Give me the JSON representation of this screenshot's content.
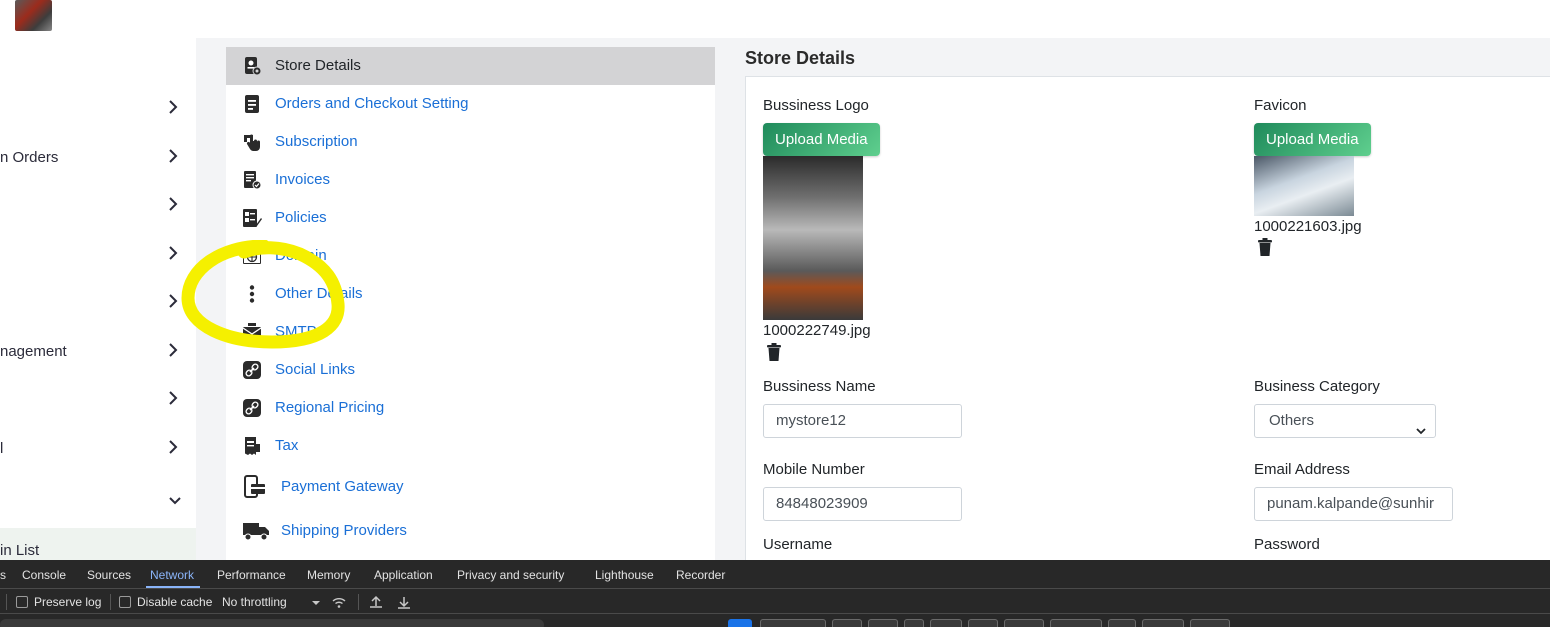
{
  "app_sidebar": {
    "items": [
      {
        "label": ""
      },
      {
        "label": "n Orders"
      },
      {
        "label": ""
      },
      {
        "label": ""
      },
      {
        "label": ""
      },
      {
        "label": "nagement"
      },
      {
        "label": ""
      },
      {
        "label": "l"
      }
    ],
    "bottom_label": "in List"
  },
  "settings_menu": {
    "items": [
      {
        "label": "Store Details",
        "icon": "store-icon"
      },
      {
        "label": "Orders and Checkout Setting",
        "icon": "document-icon"
      },
      {
        "label": "Subscription",
        "icon": "hand-pointer-icon"
      },
      {
        "label": "Invoices",
        "icon": "invoice-icon"
      },
      {
        "label": "Policies",
        "icon": "policy-icon"
      },
      {
        "label": "Domain",
        "icon": "globe-window-icon"
      },
      {
        "label": "Other Details",
        "icon": "more-vertical-icon"
      },
      {
        "label": "SMTP",
        "icon": "mail-icon"
      },
      {
        "label": "Social Links",
        "icon": "link-icon"
      },
      {
        "label": "Regional Pricing",
        "icon": "link-icon"
      },
      {
        "label": "Tax",
        "icon": "tax-receipt-icon"
      },
      {
        "label": "Payment Gateway",
        "icon": "payment-icon"
      },
      {
        "label": "Shipping Providers",
        "icon": "truck-icon"
      }
    ]
  },
  "store_details": {
    "title": "Store Details",
    "business_logo_label": "Bussiness Logo",
    "favicon_label": "Favicon",
    "upload_label": "Upload Media",
    "logo_filename": "1000222749.jpg",
    "favicon_filename": "1000221603.jpg",
    "business_name_label": "Bussiness Name",
    "business_name_value": "mystore12",
    "business_category_label": "Business Category",
    "business_category_value": "Others",
    "mobile_label": "Mobile Number",
    "mobile_value": "84848023909",
    "email_label": "Email Address",
    "email_value": "punam.kalpande@sunhir",
    "username_label": "Username",
    "password_label": "Password"
  },
  "devtools": {
    "tabs": [
      "s",
      "Console",
      "Sources",
      "Network",
      "Performance",
      "Memory",
      "Application",
      "Privacy and security",
      "Lighthouse",
      "Recorder"
    ],
    "active_tab": "Network",
    "preserve_log": "Preserve log",
    "disable_cache": "Disable cache",
    "throttling": "No throttling"
  },
  "colors": {
    "link": "#1a6fd6",
    "active_menu_bg": "#d3d3d5",
    "upload_button": "#1f8a5b",
    "highlight": "#f5f000",
    "devtools_bg": "#282828"
  }
}
